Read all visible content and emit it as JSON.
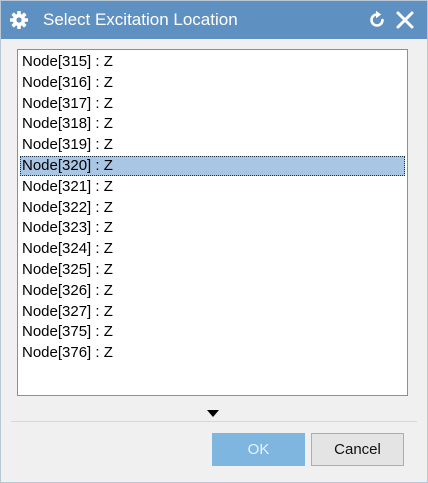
{
  "dialog": {
    "title": "Select Excitation Location",
    "icons": {
      "gear": "gear-icon",
      "reset": "reset-icon",
      "close": "close-icon",
      "expand": "chevron-down-icon"
    }
  },
  "list": {
    "selected_index": 5,
    "items": [
      "Node[315] : Z",
      "Node[316] : Z",
      "Node[317] : Z",
      "Node[318] : Z",
      "Node[319] : Z",
      "Node[320] : Z",
      "Node[321] : Z",
      "Node[322] : Z",
      "Node[323] : Z",
      "Node[324] : Z",
      "Node[325] : Z",
      "Node[326] : Z",
      "Node[327] : Z",
      "Node[375] : Z",
      "Node[376] : Z"
    ]
  },
  "buttons": {
    "ok_label": "OK",
    "cancel_label": "Cancel"
  },
  "colors": {
    "titlebar": "#5f90c2",
    "selection": "#a9c6e4",
    "ok_button": "#7eb6df"
  }
}
